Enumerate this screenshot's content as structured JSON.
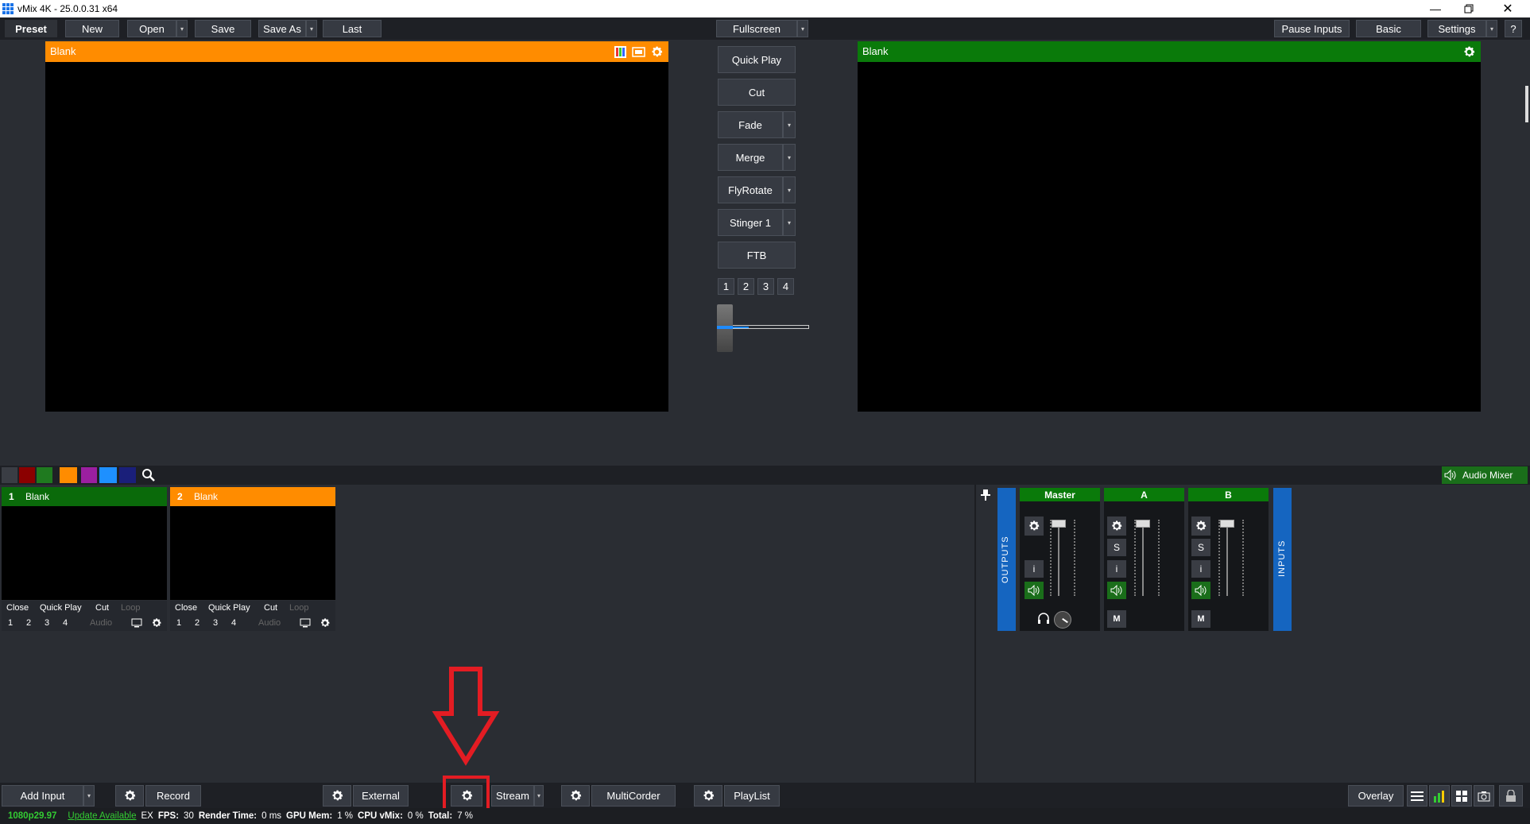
{
  "window": {
    "title": "vMix 4K - 25.0.0.31 x64"
  },
  "toolbar": {
    "preset": "Preset",
    "new": "New",
    "open": "Open",
    "save": "Save",
    "save_as": "Save As",
    "last": "Last",
    "fullscreen": "Fullscreen",
    "pause_inputs": "Pause Inputs",
    "basic": "Basic",
    "settings": "Settings",
    "help": "?"
  },
  "preview": {
    "title": "Blank",
    "color": "#ff8c00"
  },
  "output": {
    "title": "Blank",
    "color": "#0a7a0a"
  },
  "transitions": {
    "quick_play": "Quick Play",
    "cut": "Cut",
    "fade": "Fade",
    "merge": "Merge",
    "flyrotate": "FlyRotate",
    "stinger": "Stinger 1",
    "ftb": "FTB",
    "numbers": [
      "1",
      "2",
      "3",
      "4"
    ]
  },
  "color_tags": [
    "#3a3d44",
    "#8b0000",
    "#1f7a1f",
    "#ff8c00",
    "#9b1fa0",
    "#1e90ff",
    "#1a1f7a"
  ],
  "audio_mixer_label": "Audio Mixer",
  "inputs": [
    {
      "number": "1",
      "name": "Blank",
      "color": "#0a6a0a",
      "controls": [
        "Close",
        "Quick Play",
        "Cut",
        "Loop"
      ],
      "nums": [
        "1",
        "2",
        "3",
        "4"
      ],
      "audio": "Audio"
    },
    {
      "number": "2",
      "name": "Blank",
      "color": "#ff8c00",
      "controls": [
        "Close",
        "Quick Play",
        "Cut",
        "Loop"
      ],
      "nums": [
        "1",
        "2",
        "3",
        "4"
      ],
      "audio": "Audio"
    }
  ],
  "mixer": {
    "outputs_label": "OUTPUTS",
    "inputs_label": "INPUTS",
    "channels": [
      {
        "name": "Master",
        "buttons": [
          "i"
        ],
        "mute": ""
      },
      {
        "name": "A",
        "buttons": [
          "S",
          "i"
        ],
        "mute": "M"
      },
      {
        "name": "B",
        "buttons": [
          "S",
          "i"
        ],
        "mute": "M"
      }
    ]
  },
  "bottombar": {
    "add_input": "Add Input",
    "record": "Record",
    "external": "External",
    "stream": "Stream",
    "multicorder": "MultiCorder",
    "playlist": "PlayList",
    "overlay": "Overlay"
  },
  "status": {
    "format": "1080p29.97",
    "update": "Update Available",
    "ex": "EX",
    "fps_label": "FPS:",
    "fps": "30",
    "render_label": "Render Time:",
    "render": "0 ms",
    "gpu_label": "GPU Mem:",
    "gpu": "1 %",
    "cpu_label": "CPU vMix:",
    "cpu": "0 %",
    "total_label": "Total:",
    "total": "7 %"
  },
  "annotation": {
    "color": "#e31c23"
  }
}
